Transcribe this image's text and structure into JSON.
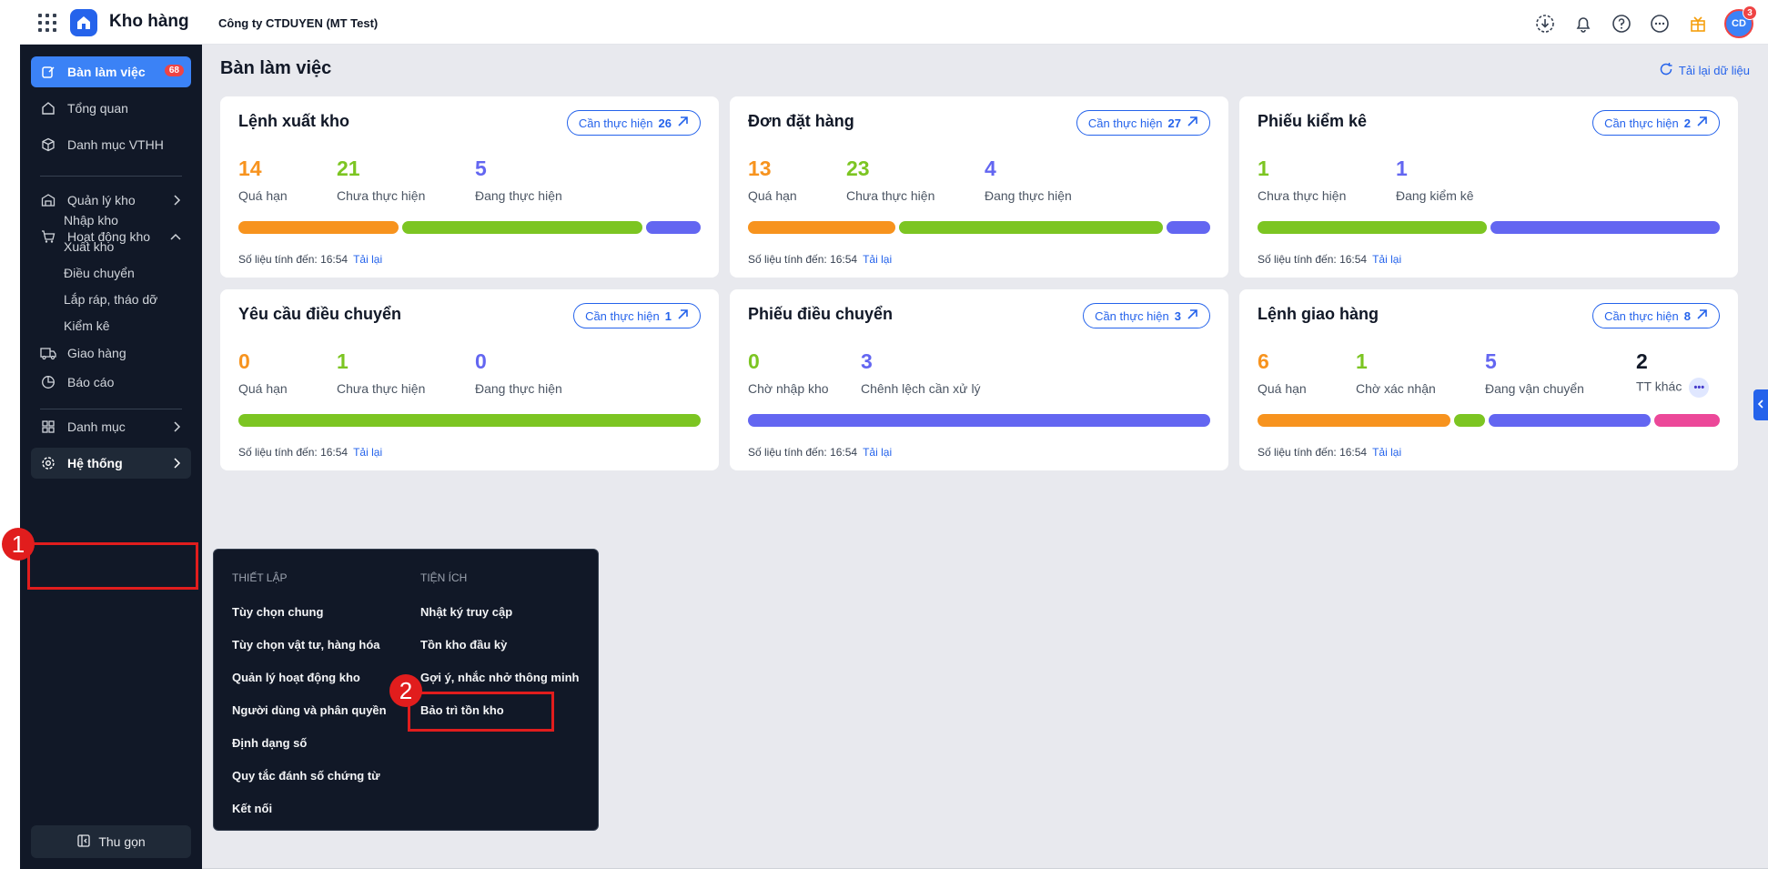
{
  "header": {
    "app_name": "Kho hàng",
    "company": "Công ty CTDUYEN (MT Test)",
    "avatar_initials": "CD",
    "avatar_badge": "3"
  },
  "sidebar": {
    "workspace": {
      "label": "Bàn làm việc",
      "badge": "68"
    },
    "overview": "Tổng quan",
    "catalog_vthh": "Danh mục VTHH",
    "warehouse_mgmt": "Quản lý kho",
    "warehouse_ops": "Hoạt động kho",
    "ops_sub": [
      "Nhập kho",
      "Xuất kho",
      "Điều chuyển",
      "Lắp ráp, tháo dỡ",
      "Kiểm kê"
    ],
    "delivery": "Giao hàng",
    "report": "Báo cáo",
    "categories": "Danh mục",
    "system": "Hệ thống",
    "collapse": "Thu gọn"
  },
  "main": {
    "title": "Bàn làm việc",
    "reload_all": "Tải lại dữ liệu",
    "cards": [
      {
        "title": "Lệnh xuất kho",
        "btn_label": "Cần thực hiện",
        "btn_count": "26",
        "stats": [
          {
            "num": "14",
            "label": "Quá hạn"
          },
          {
            "num": "21",
            "label": "Chưa thực hiện"
          },
          {
            "num": "5",
            "label": "Đang thực hiện"
          }
        ],
        "foot": "Số liệu tính đến: 16:54",
        "foot_link": "Tải lại"
      },
      {
        "title": "Đơn đặt hàng",
        "btn_label": "Cần thực hiện",
        "btn_count": "27",
        "stats": [
          {
            "num": "13",
            "label": "Quá hạn"
          },
          {
            "num": "23",
            "label": "Chưa thực hiện"
          },
          {
            "num": "4",
            "label": "Đang thực hiện"
          }
        ],
        "foot": "Số liệu tính đến: 16:54",
        "foot_link": "Tải lại"
      },
      {
        "title": "Phiếu kiểm kê",
        "btn_label": "Cần thực hiện",
        "btn_count": "2",
        "stats": [
          {
            "num": "1",
            "label": "Chưa thực hiện"
          },
          {
            "num": "1",
            "label": "Đang kiểm kê"
          }
        ],
        "foot": "Số liệu tính đến: 16:54",
        "foot_link": "Tải lại"
      },
      {
        "title": "Yêu cầu điều chuyển",
        "btn_label": "Cần thực hiện",
        "btn_count": "1",
        "stats": [
          {
            "num": "0",
            "label": "Quá hạn"
          },
          {
            "num": "1",
            "label": "Chưa thực hiện"
          },
          {
            "num": "0",
            "label": "Đang thực hiện"
          }
        ],
        "foot": "Số liệu tính đến: 16:54",
        "foot_link": "Tải lại"
      },
      {
        "title": "Phiếu điều chuyển",
        "btn_label": "Cần thực hiện",
        "btn_count": "3",
        "stats": [
          {
            "num": "0",
            "label": "Chờ nhập kho"
          },
          {
            "num": "3",
            "label": "Chênh lệch cần xử lý"
          }
        ],
        "foot": "Số liệu tính đến: 16:54",
        "foot_link": "Tải lại"
      },
      {
        "title": "Lệnh giao hàng",
        "btn_label": "Cần thực hiện",
        "btn_count": "8",
        "stats": [
          {
            "num": "6",
            "label": "Quá hạn"
          },
          {
            "num": "1",
            "label": "Chờ xác nhận"
          },
          {
            "num": "5",
            "label": "Đang vận chuyển"
          },
          {
            "num": "2",
            "label": "TT khác"
          }
        ],
        "foot": "Số liệu tính đến: 16:54",
        "foot_link": "Tải lại"
      }
    ]
  },
  "flyout": {
    "col1_head": "THIẾT LẬP",
    "col1": [
      "Tùy chọn chung",
      "Tùy chọn vật tư, hàng hóa",
      "Quản lý hoạt động kho",
      "Người dùng và phân quyền",
      "Định dạng số",
      "Quy tắc đánh số chứng từ",
      "Kết nối"
    ],
    "col2_head": "TIỆN ÍCH",
    "col2": [
      "Nhật ký truy cập",
      "Tồn kho đầu kỳ",
      "Gợi ý, nhắc nhở thông minh",
      "Bảo trì tồn kho"
    ]
  },
  "annotations": {
    "marker1": "1",
    "marker2": "2"
  },
  "colors": {
    "orange": "#f7931e",
    "green": "#7cc522",
    "purple": "#6366f1",
    "pink": "#ec4899",
    "accent": "#2563eb"
  }
}
